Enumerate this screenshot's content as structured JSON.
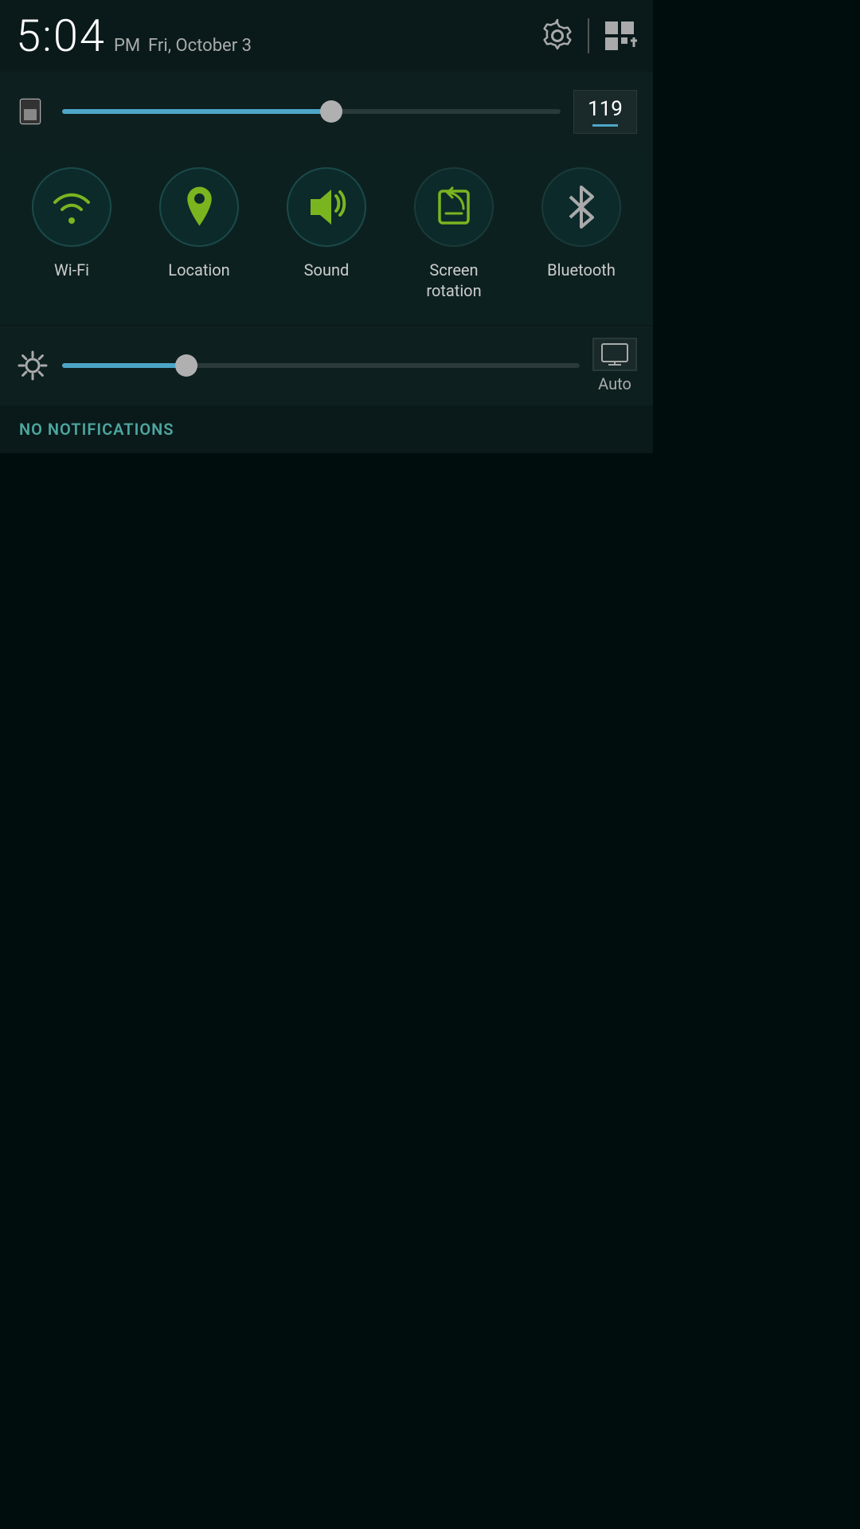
{
  "statusBar": {
    "time": "5:04",
    "period": "PM",
    "date": "Fri, October 3"
  },
  "brightness": {
    "value": "119",
    "sliderPercent": 54,
    "thumbPercent": 54
  },
  "brightness2": {
    "sliderPercent": 24,
    "thumbPercent": 24,
    "autoLabel": "Auto"
  },
  "toggles": [
    {
      "id": "wifi",
      "label": "Wi-Fi",
      "active": true
    },
    {
      "id": "location",
      "label": "Location",
      "active": true
    },
    {
      "id": "sound",
      "label": "Sound",
      "active": true
    },
    {
      "id": "screen-rotation",
      "label": "Screen\nrotation",
      "active": false
    },
    {
      "id": "bluetooth",
      "label": "Bluetooth",
      "active": false
    }
  ],
  "notifications": {
    "emptyLabel": "NO NOTIFICATIONS"
  }
}
